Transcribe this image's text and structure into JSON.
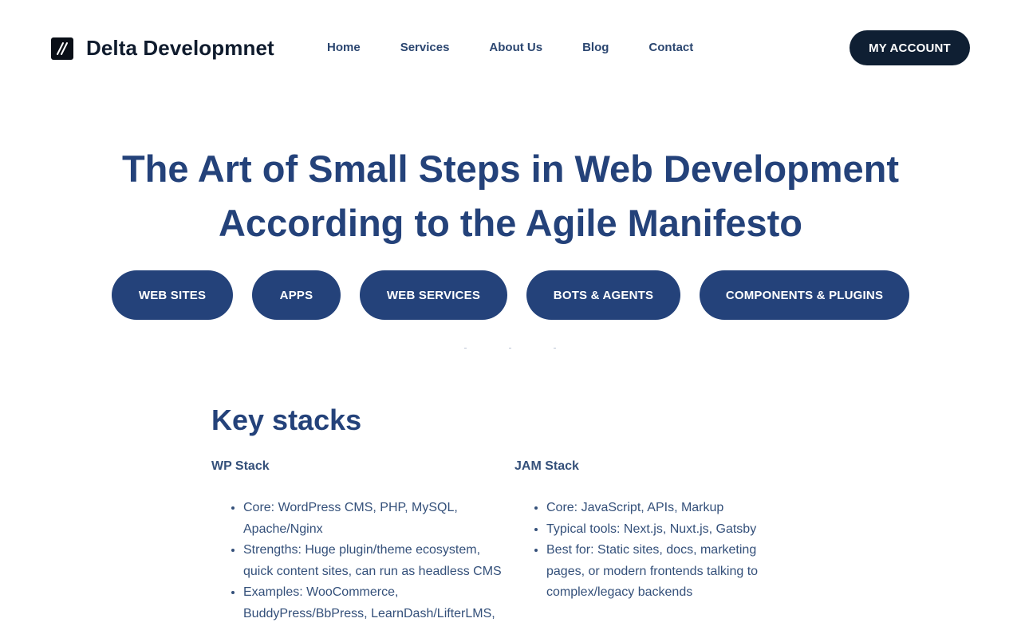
{
  "brand": {
    "name": "Delta Developmnet",
    "icon": "double-slash-logo-icon"
  },
  "nav": [
    "Home",
    "Services",
    "About Us",
    "Blog",
    "Contact"
  ],
  "account_button": "MY ACCOUNT",
  "hero": {
    "line1": "The Art of Small Steps in Web Development",
    "line2": "According to the Agile Manifesto"
  },
  "pills": [
    "WEB SITES",
    "APPS",
    "WEB SERVICES",
    "BOTS & AGENTS",
    "COMPONENTS & PLUGINS"
  ],
  "stacks": {
    "heading": "Key stacks",
    "wp": {
      "title": "WP Stack",
      "items": [
        "Core: WordPress CMS, PHP, MySQL, Apache/Nginx",
        "Strengths: Huge plugin/theme ecosystem, quick content sites, can run as headless CMS",
        "Examples: WooCommerce, BuddyPress/BbPress, LearnDash/LifterLMS,"
      ]
    },
    "jam": {
      "title": "JAM Stack",
      "items": [
        "Core: JavaScript, APIs, Markup",
        "Typical tools: Next.js, Nuxt.js, Gatsby",
        "Best for: Static sites, docs, marketing pages, or modern frontends talking to complex/legacy backends"
      ]
    }
  },
  "colors": {
    "primary": "#24427a",
    "dark": "#0f1f33",
    "text": "#34507a"
  }
}
